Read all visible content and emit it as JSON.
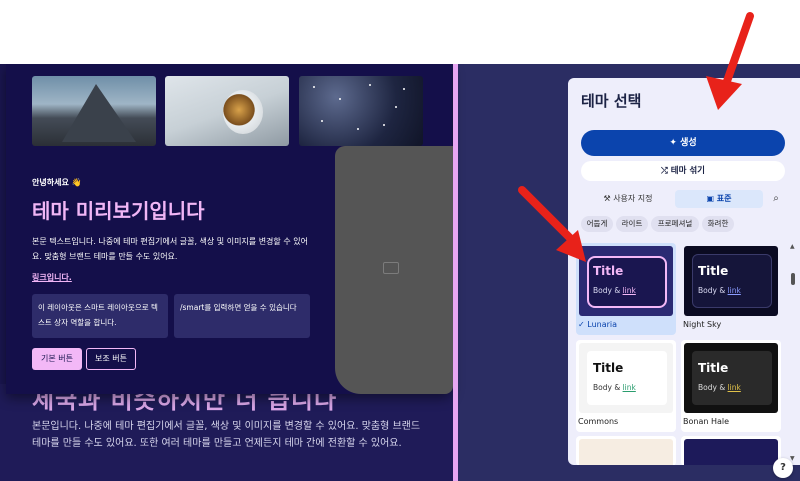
{
  "preview": {
    "greeting": "안녕하세요 👋",
    "title": "테마 미리보기입니다",
    "body": "본문 텍스트입니다. 나중에 테마 편집기에서 글꼴, 색상 및 이미지를 변경할 수 있어요. 맞춤형 브랜드 테마를 만들 수도 있어요.",
    "link": "링크입니다.",
    "box1": "이 레이아웃은 스마트 레이아웃으로 텍스트 상자 역할을 합니다.",
    "box2": "/smart를 입력하면 얻을 수 있습니다",
    "primary_button": "기본 버튼",
    "secondary_button": "보조 버튼",
    "bottom_heading": "세국과 비슷하지만 더 큽니다",
    "bottom_body": "본문입니다. 나중에 테마 편집기에서 글꼴, 색상 및 이미지를 변경할 수 있어요. 맞춤형 브랜드 테마를 만들 수도 있어요. 또한 여러 테마를 만들고 언제든지 테마 간에 전환할 수 있어요."
  },
  "panel": {
    "title": "테마 선택",
    "generate_label": "생성",
    "shuffle_label": "테마 섞기",
    "tabs": {
      "custom": "사용자 지정",
      "standard": "표준"
    },
    "chips": [
      "어둡게",
      "라이트",
      "프로페셔널",
      "화려한"
    ],
    "themes": [
      {
        "name": "Lunaria",
        "title": "Title",
        "body": "Body & ",
        "link": "link",
        "selected": true
      },
      {
        "name": "Night Sky",
        "title": "Title",
        "body": "Body & ",
        "link": "link"
      },
      {
        "name": "Commons",
        "title": "Title",
        "body": "Body & ",
        "link": "link"
      },
      {
        "name": "Bonan Hale",
        "title": "Title",
        "body": "Body & ",
        "link": "link"
      }
    ]
  },
  "help": "?",
  "colors": {
    "accent": "#0b44ad",
    "preview_pink": "#f1b6f6",
    "annotation_arrow": "#e8221a"
  }
}
